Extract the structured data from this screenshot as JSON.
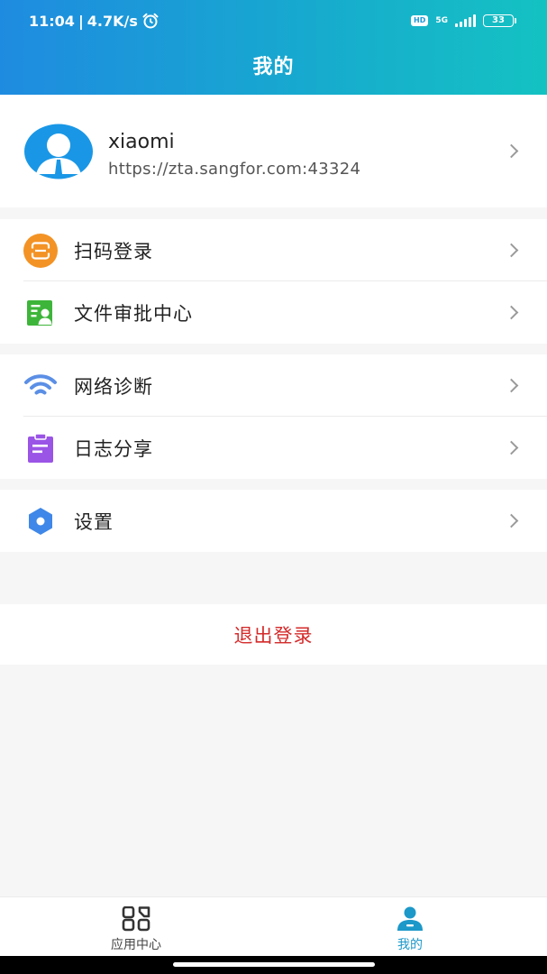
{
  "status_bar": {
    "time": "11:04",
    "separator": "|",
    "speed": "4.7K/s",
    "hd": "HD",
    "network": "5G",
    "battery": "33"
  },
  "header": {
    "title": "我的"
  },
  "profile": {
    "name": "xiaomi",
    "url": "https://zta.sangfor.com:43324"
  },
  "menu": {
    "scan_login": "扫码登录",
    "file_approval": "文件审批中心",
    "network_diagnosis": "网络诊断",
    "log_share": "日志分享",
    "settings": "设置"
  },
  "logout_label": "退出登录",
  "tabs": {
    "apps": "应用中心",
    "mine": "我的"
  },
  "colors": {
    "accent": "#1c98c9",
    "logout": "#d42a2a",
    "scan_icon": "#f39325",
    "file_icon": "#3db53a",
    "wifi_icon": "#5b8fe6",
    "log_icon": "#9a54e6",
    "settings_icon": "#3f87e8"
  }
}
